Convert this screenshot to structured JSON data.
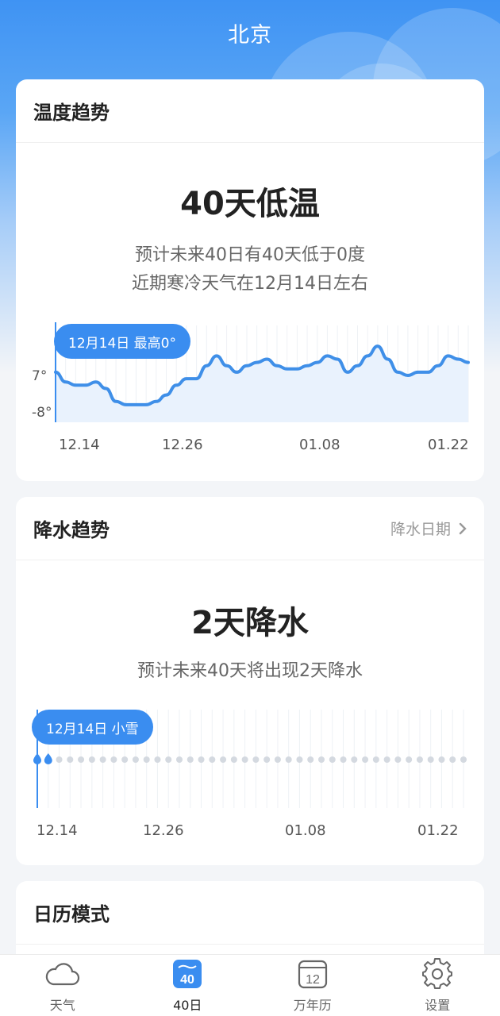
{
  "header": {
    "city": "北京"
  },
  "temperature": {
    "title": "温度趋势",
    "headline": "40天低温",
    "desc_line1": "预计未来40日有40天低于0度",
    "desc_line2": "近期寒冷天气在12月14日左右",
    "tooltip": "12月14日 最高0°",
    "y_labels": [
      "7°",
      "-8°"
    ],
    "x_labels": [
      "12.14",
      "12.26",
      "01.08",
      "01.22"
    ]
  },
  "precipitation": {
    "title": "降水趋势",
    "link": "降水日期",
    "headline": "2天降水",
    "desc": "预计未来40天将出现2天降水",
    "tooltip": "12月14日 小雪",
    "x_labels": [
      "12.14",
      "12.26",
      "01.08",
      "01.22"
    ]
  },
  "calendar": {
    "title": "日历模式"
  },
  "tabbar": {
    "tabs": [
      {
        "label": "天气",
        "icon": "cloud-icon"
      },
      {
        "label": "40日",
        "icon": "forty-day-icon"
      },
      {
        "label": "万年历",
        "icon": "calendar-icon"
      },
      {
        "label": "设置",
        "icon": "gear-icon"
      }
    ],
    "forty_icon_text": "40",
    "calendar_icon_text": "12"
  },
  "colors": {
    "accent": "#3a8df0",
    "line": "#3f8fe8",
    "rain_dot": "#3a8df0",
    "no_rain_dot": "#d4d9e0"
  },
  "chart_data": [
    {
      "type": "area",
      "title": "",
      "ylim": [
        -10,
        10
      ],
      "y_ticks": [
        7,
        -8
      ],
      "x_ticks": [
        "12.14",
        "12.26",
        "01.08",
        "01.22"
      ],
      "series": [
        {
          "values": [
            1,
            -2,
            -3,
            -3,
            -2,
            -4,
            -8,
            -9,
            -9,
            -9,
            -8,
            -6,
            -3,
            -1,
            -1,
            3,
            6,
            3,
            1,
            3,
            4,
            5,
            3,
            2,
            2,
            3,
            4,
            6,
            5,
            1,
            3,
            6,
            9,
            5,
            1,
            0,
            1,
            1,
            3,
            6,
            5,
            4
          ]
        }
      ]
    },
    {
      "type": "scatter",
      "title": "",
      "x_ticks": [
        "12.14",
        "12.26",
        "01.08",
        "01.22"
      ],
      "days": 40,
      "rain_days": [
        0,
        1
      ]
    }
  ]
}
